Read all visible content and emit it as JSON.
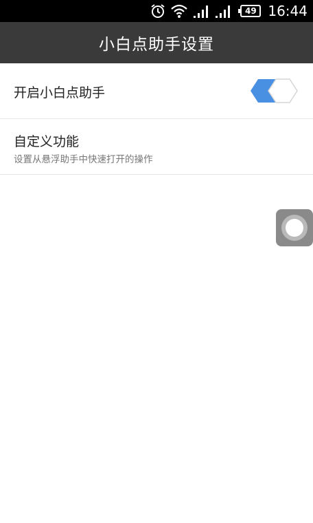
{
  "status_bar": {
    "battery": "49",
    "time": "16:44",
    "icons": [
      "alarm-icon",
      "wifi-icon",
      "signal-icon",
      "signal-icon",
      "battery-icon"
    ]
  },
  "action_bar": {
    "title": "小白点助手设置"
  },
  "settings": {
    "toggle_item": {
      "label": "开启小白点助手",
      "enabled": true,
      "accent_color": "#4a90e2"
    },
    "custom_item": {
      "title": "自定义功能",
      "subtitle": "设置从悬浮助手中快速打开的操作"
    }
  },
  "floating_button": {
    "icon": "assistive-touch-icon"
  }
}
